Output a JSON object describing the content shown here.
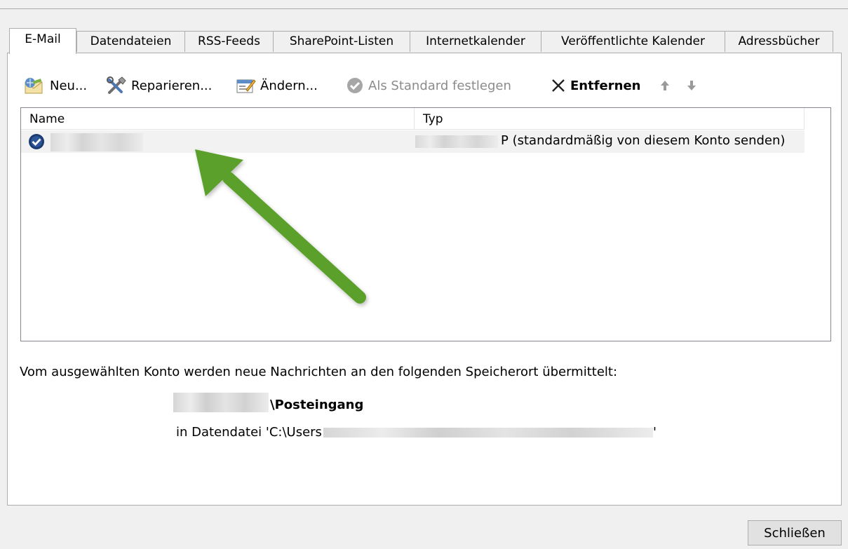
{
  "tabs": [
    {
      "label": "E-Mail"
    },
    {
      "label": "Datendateien"
    },
    {
      "label": "RSS-Feeds"
    },
    {
      "label": "SharePoint-Listen"
    },
    {
      "label": "Internetkalender"
    },
    {
      "label": "Veröffentlichte Kalender"
    },
    {
      "label": "Adressbücher"
    }
  ],
  "toolbar": {
    "new_label": "Neu...",
    "repair_label": "Reparieren...",
    "change_label": "Ändern...",
    "default_label": "Als Standard festlegen",
    "remove_label": "Entfernen"
  },
  "list": {
    "columns": {
      "name": "Name",
      "type": "Typ"
    },
    "rows": [
      {
        "type_suffix": "P (standardmäßig von diesem Konto senden)"
      }
    ]
  },
  "delivery": {
    "text": "Vom ausgewählten Konto werden neue Nachrichten an den folgenden Speicherort übermittelt:",
    "folder_suffix": "\\Posteingang",
    "file_prefix": "in Datendatei 'C:\\Users",
    "file_suffix": "'"
  },
  "close_label": "Schließen",
  "colors": {
    "arrow": "#5aa02c",
    "check_badge": "#1b3b73",
    "up_down_arrows": "#9a9a9a"
  }
}
